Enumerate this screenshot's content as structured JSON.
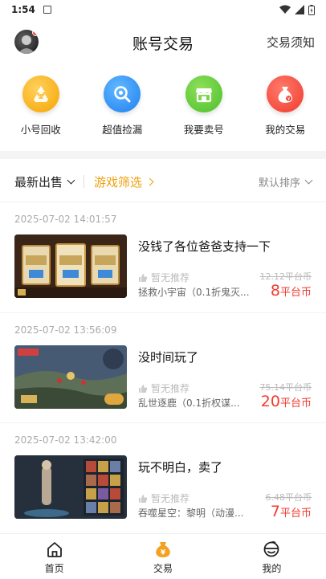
{
  "status_bar": {
    "time": "1:54"
  },
  "header": {
    "title": "账号交易",
    "notice_label": "交易须知"
  },
  "entries": [
    {
      "label": "小号回收",
      "icon": "recycle-icon",
      "color": "#f5a400"
    },
    {
      "label": "超值捡漏",
      "icon": "magnifier-icon",
      "color": "#1f7ff0"
    },
    {
      "label": "我要卖号",
      "icon": "store-icon",
      "color": "#4cbf2a"
    },
    {
      "label": "我的交易",
      "icon": "money-bag-icon",
      "color": "#ef3a2e"
    }
  ],
  "filters": {
    "latest": "最新出售",
    "game_filter": "游戏筛选",
    "sort": "默认排序"
  },
  "listings": [
    {
      "date": "2025-07-02 14:01:57",
      "title": "没钱了各位爸爸支持一下",
      "recommend": "暂无推荐",
      "game": "拯救小宇宙（0.1折鬼灭...",
      "original_price": "12.12平台币",
      "price": "8",
      "unit": "平台币"
    },
    {
      "date": "2025-07-02 13:56:09",
      "title": "没时间玩了",
      "recommend": "暂无推荐",
      "game": "乱世逐鹿（0.1折权谋...",
      "original_price": "75.14平台币",
      "price": "20",
      "unit": "平台币"
    },
    {
      "date": "2025-07-02 13:42:00",
      "title": "玩不明白，卖了",
      "recommend": "暂无推荐",
      "game": "吞噬星空：黎明（动漫...",
      "original_price": "6.48平台币",
      "price": "7",
      "unit": "平台币"
    }
  ],
  "tabbar": [
    {
      "label": "首页",
      "icon": "home-icon"
    },
    {
      "label": "交易",
      "icon": "trade-icon",
      "active": true
    },
    {
      "label": "我的",
      "icon": "profile-icon"
    }
  ],
  "colors": {
    "accent": "#f0a010",
    "price": "#f23b2f"
  }
}
